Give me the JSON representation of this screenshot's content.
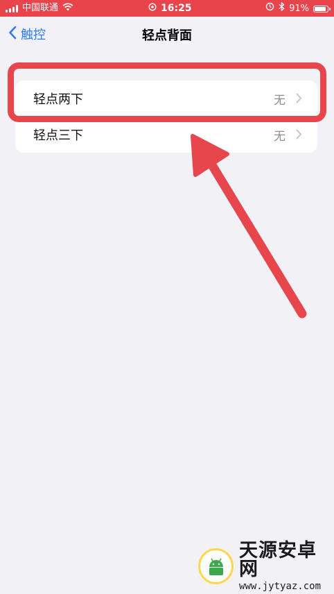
{
  "status_bar": {
    "carrier": "中国联通",
    "time": "16:25",
    "battery": "91%",
    "battery_level": 0.91,
    "icons": [
      "signal-icon",
      "wifi-icon",
      "orientation-lock-icon",
      "alarm-icon",
      "bluetooth-icon",
      "battery-icon"
    ]
  },
  "nav": {
    "back_label": "触控",
    "title": "轻点背面"
  },
  "list": {
    "items": [
      {
        "label": "轻点两下",
        "value": "无"
      },
      {
        "label": "轻点三下",
        "value": "无"
      }
    ]
  },
  "annotation": {
    "color": "#e8464d"
  },
  "watermark": {
    "title": "天源安卓网",
    "url": "www.jytyaz.com"
  },
  "colors": {
    "accent": "#2d7cf6",
    "background": "#f2f1f6",
    "status_bar": "#e9444c",
    "secondary_text": "#8e8e93"
  }
}
